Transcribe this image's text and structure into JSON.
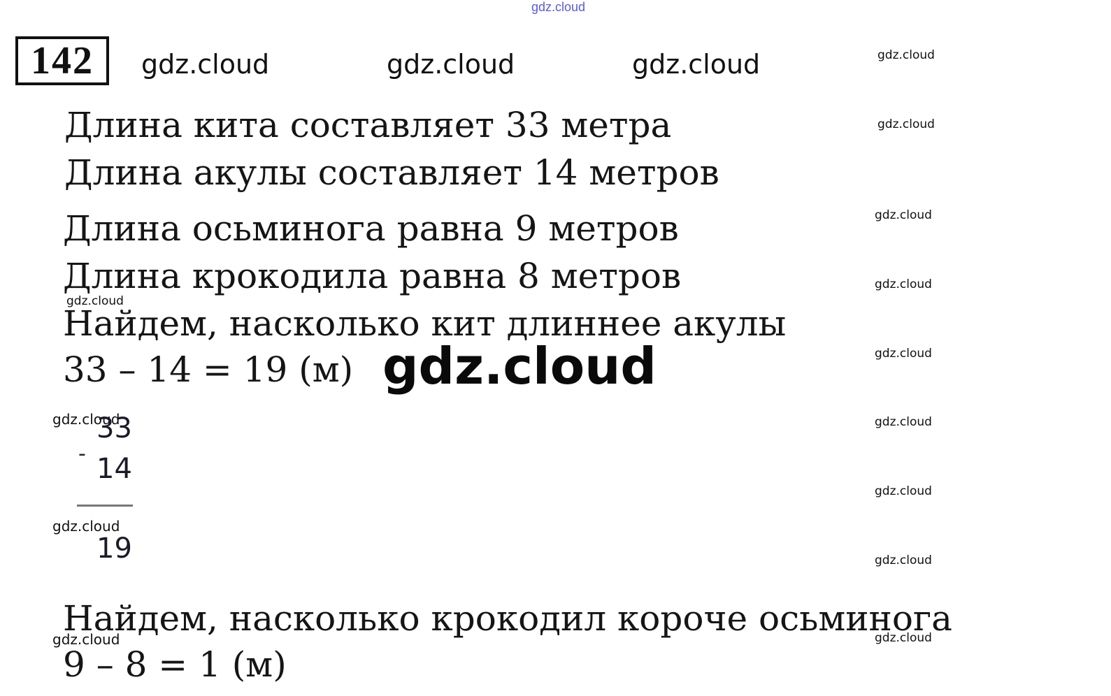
{
  "watermark": "gdz.cloud",
  "task": {
    "number": "142"
  },
  "lines": [
    "Длина кита составляет 33 метра",
    "Длина акулы составляет 14 метров",
    "Длина осьминога равна 9 метров",
    "Длина крокодила равна 8 метров",
    "Найдем, насколько кит длиннее акулы",
    "33 – 14 = 19 (м)",
    "Найдем, насколько крокодил короче осьминога",
    "9 – 8 = 1 (м)"
  ],
  "column_subtraction": {
    "minuend": "33",
    "operator": "-",
    "subtrahend": "14",
    "result": "19"
  }
}
